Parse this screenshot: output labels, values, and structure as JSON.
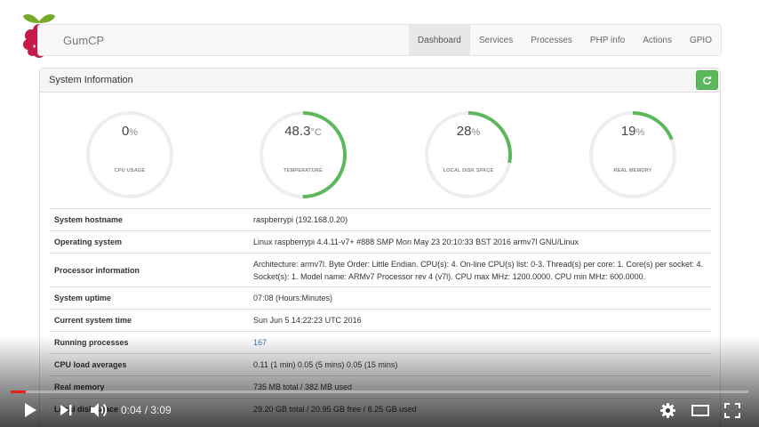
{
  "app": {
    "brand": "GumCP",
    "nav": [
      {
        "label": "Dashboard",
        "active": true
      },
      {
        "label": "Services"
      },
      {
        "label": "Processes"
      },
      {
        "label": "PHP info"
      },
      {
        "label": "Actions"
      },
      {
        "label": "GPIO"
      }
    ]
  },
  "panel": {
    "title": "System Information",
    "refresh_icon": "refresh-icon"
  },
  "gauges": [
    {
      "value": "0",
      "unit": "%",
      "label": "CPU USAGE",
      "percent": 0
    },
    {
      "value": "48.3",
      "unit": "°C",
      "label": "TEMPERATURE",
      "percent": 50
    },
    {
      "value": "28",
      "unit": "%",
      "label": "LOCAL DISK SPACE",
      "percent": 28
    },
    {
      "value": "19",
      "unit": "%",
      "label": "REAL MEMORY",
      "percent": 19
    }
  ],
  "info": [
    {
      "key": "System hostname",
      "value": "raspberrypi (192.168.0.20)"
    },
    {
      "key": "Operating system",
      "value": "Linux raspberrypi 4.4.11-v7+ #888 SMP Mon May 23 20:10:33 BST 2016 armv7l GNU/Linux"
    },
    {
      "key": "Processor information",
      "value": "Architecture: armv7l. Byte Order: Little Endian. CPU(s): 4. On-line CPU(s) list: 0-3. Thread(s) per core: 1. Core(s) per socket: 4. Socket(s): 1. Model name: ARMv7 Processor rev 4 (v7l). CPU max MHz: 1200.0000. CPU min MHz: 600.0000."
    },
    {
      "key": "System uptime",
      "value": "07:08 (Hours:Minutes)"
    },
    {
      "key": "Current system time",
      "value": "Sun Jun 5 14:22:23 UTC 2016"
    },
    {
      "key": "Running processes",
      "value": "167",
      "link": true
    },
    {
      "key": "CPU load averages",
      "value": "0.11 (1 min) 0.05 (5 mins) 0.05 (15 mins)"
    },
    {
      "key": "Real memory",
      "value": "735 MB total / 382 MB used"
    },
    {
      "key": "Local disk space",
      "value": "29.20 GB total / 20.95 GB free / 8.25 GB used"
    }
  ],
  "player": {
    "current_time": "0:04",
    "duration": "3:09",
    "time_display": "0:04 / 3:09",
    "progress": 0.021,
    "accent": "#e62117",
    "icons": [
      "play-icon",
      "next-icon",
      "volume-icon",
      "settings-icon",
      "theater-icon",
      "fullscreen-icon"
    ]
  },
  "colors": {
    "gauge_fill": "#5cb85c",
    "gauge_track": "#eeeeee",
    "refresh_button": "#5cb85c",
    "link": "#337ab7"
  }
}
